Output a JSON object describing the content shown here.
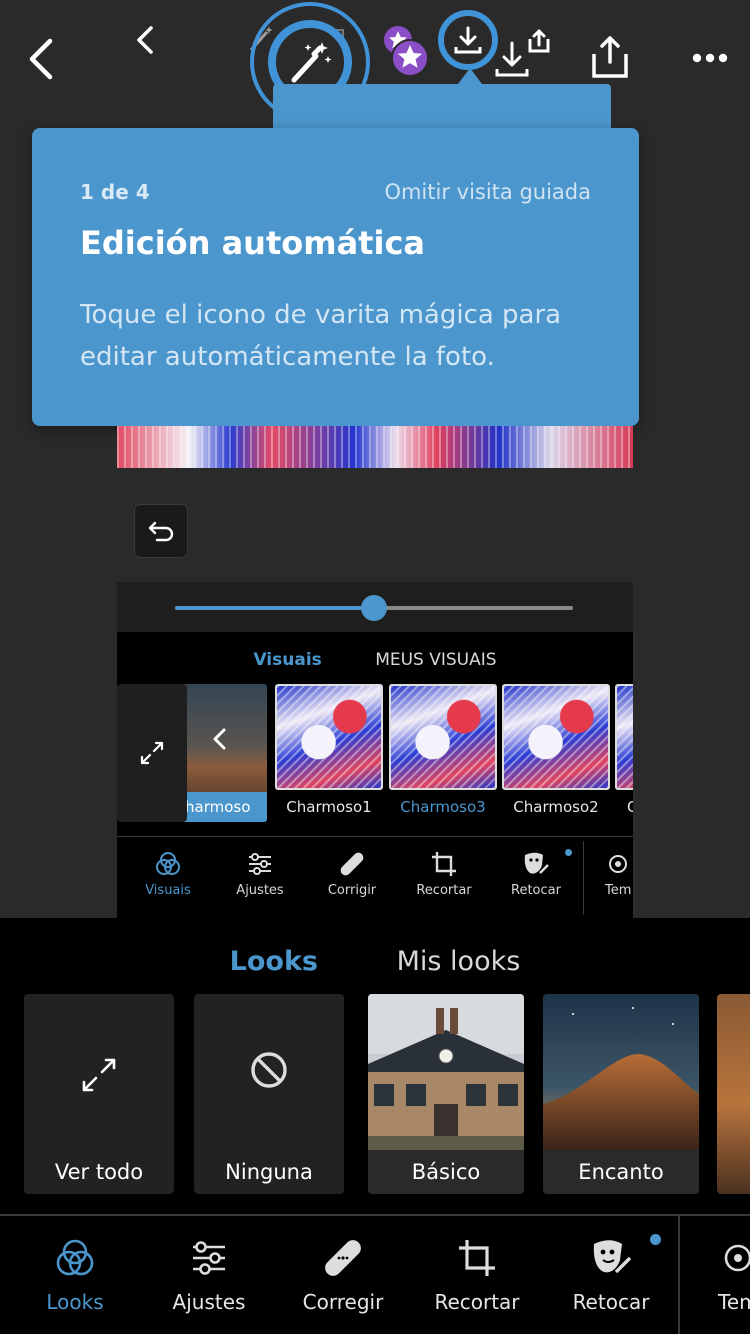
{
  "colors": {
    "accent": "#4b97cd",
    "tooltip": "#4b97cd",
    "background": "#2a2a2a",
    "panel": "#000000"
  },
  "toolbar": {
    "icons": [
      "back-icon",
      "back-small-icon",
      "magic-wand-icon",
      "premium-star-icon",
      "download-icon",
      "download-alt-icon",
      "share-icon",
      "more-icon"
    ]
  },
  "tooltip": {
    "step": "1 de 4",
    "skip_label": "Omitir visita guiada",
    "title": "Edición automática",
    "body": "Toque el icono de varita mágica para editar automáticamente la foto."
  },
  "embedded": {
    "slider_value": 0.5,
    "tabs": {
      "active": "Visuais",
      "other": "MEUS VISUAIS"
    },
    "thumbs": [
      {
        "label": "harmoso",
        "active": true
      },
      {
        "label": "Charmoso1",
        "active": false
      },
      {
        "label": "Charmoso3",
        "active": true
      },
      {
        "label": "Charmoso2",
        "active": false
      },
      {
        "label": "C",
        "active": false
      }
    ],
    "nav": [
      {
        "label": "Visuais",
        "icon": "looks-icon",
        "active": true
      },
      {
        "label": "Ajustes",
        "icon": "sliders-icon",
        "active": false
      },
      {
        "label": "Corrigir",
        "icon": "bandage-icon",
        "active": false
      },
      {
        "label": "Recortar",
        "icon": "crop-icon",
        "active": false
      },
      {
        "label": "Retocar",
        "icon": "retouch-icon",
        "active": false
      },
      {
        "label": "Tem",
        "icon": "template-icon",
        "active": false
      }
    ]
  },
  "looks": {
    "tabs": {
      "active": "Looks",
      "other": "Mis looks"
    },
    "cards": [
      {
        "label": "Ver todo",
        "icon": "expand-icon"
      },
      {
        "label": "Ninguna",
        "icon": "none-icon"
      },
      {
        "label": "Básico",
        "icon": ""
      },
      {
        "label": "Encanto",
        "icon": ""
      }
    ]
  },
  "bottom_nav": [
    {
      "label": "Looks",
      "icon": "looks-icon",
      "active": true
    },
    {
      "label": "Ajustes",
      "icon": "sliders-icon",
      "active": false
    },
    {
      "label": "Corregir",
      "icon": "bandage-icon",
      "active": false
    },
    {
      "label": "Recortar",
      "icon": "crop-icon",
      "active": false
    },
    {
      "label": "Retocar",
      "icon": "retouch-icon",
      "active": false
    },
    {
      "label": "Tem",
      "icon": "template-icon",
      "active": false
    }
  ]
}
